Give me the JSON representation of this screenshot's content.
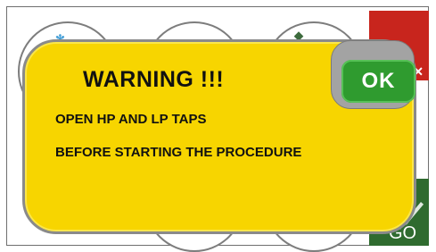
{
  "dialog": {
    "title": "WARNING !!!",
    "line1": "OPEN HP AND LP TAPS",
    "line2": "BEFORE STARTING THE PROCEDURE",
    "ok_label": "OK"
  },
  "side_buttons": {
    "go_label": "GO"
  },
  "colors": {
    "popup_yellow": "#f7d500",
    "ok_green": "#2f9b2f",
    "cancel_red": "#c8251d",
    "go_green": "#2f6b2f"
  },
  "icons": [
    "close-icon",
    "check-icon"
  ]
}
